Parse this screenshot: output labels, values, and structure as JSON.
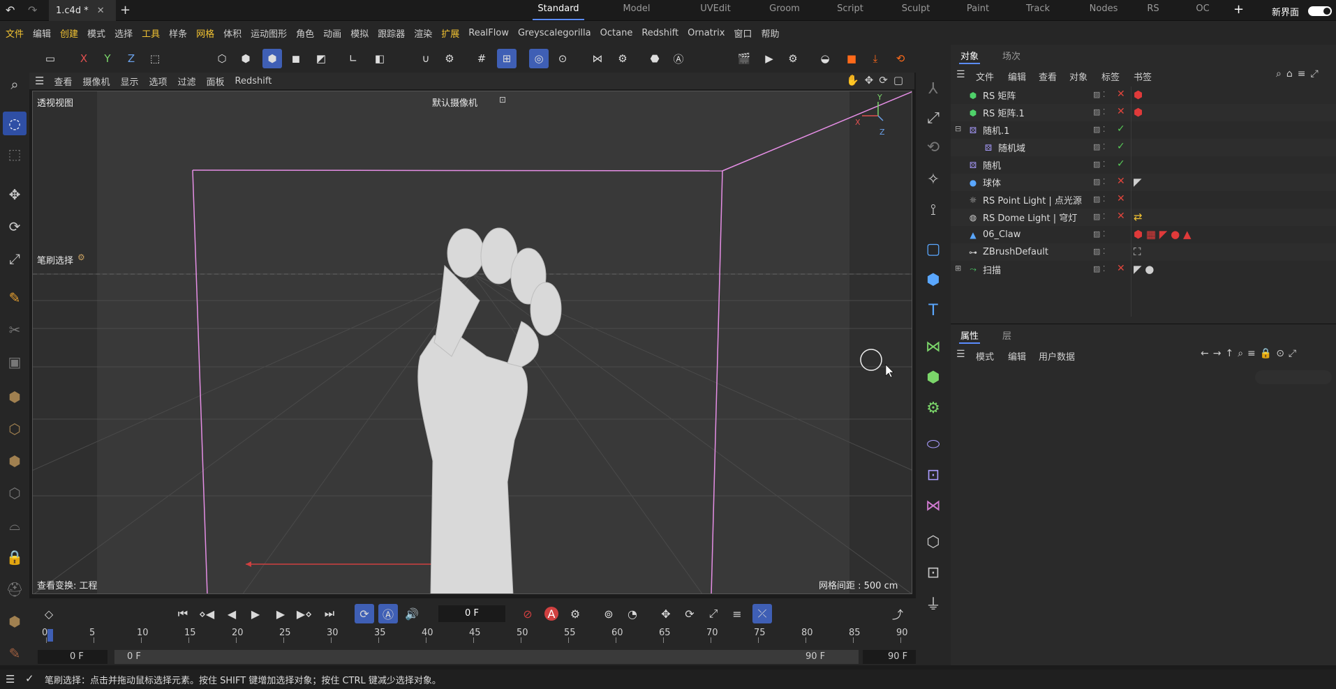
{
  "document_tab": "1.c4d *",
  "layouts": [
    "Standard",
    "Model",
    "UVEdit",
    "Groom",
    "Script",
    "Sculpt",
    "Paint",
    "Track",
    "Nodes",
    "RS",
    "OC"
  ],
  "active_layout": "Standard",
  "new_interface_label": "新界面",
  "menu": [
    "文件",
    "编辑",
    "创建",
    "模式",
    "选择",
    "工具",
    "样条",
    "网格",
    "体积",
    "运动图形",
    "角色",
    "动画",
    "模拟",
    "跟踪器",
    "渲染",
    "扩展",
    "RealFlow",
    "Greyscalegorilla",
    "Octane",
    "Redshift",
    "Ornatrix",
    "窗口",
    "帮助"
  ],
  "highlighted_menu": [
    "文件",
    "创建",
    "工具",
    "网格",
    "扩展"
  ],
  "axes": [
    "X",
    "Y",
    "Z"
  ],
  "viewport_menu": [
    "查看",
    "摄像机",
    "显示",
    "选项",
    "过滤",
    "面板",
    "Redshift"
  ],
  "viewport": {
    "view_name": "透视视图",
    "camera": "默认摄像机",
    "tool_label": "笔刷选择",
    "transform_label": "查看变换: 工程",
    "grid_spacing": "网格间距 : 500 cm",
    "axis_x": "X",
    "axis_y": "Y",
    "axis_z": "Z"
  },
  "object_panel": {
    "tabs": [
      "对象",
      "场次"
    ],
    "menu": [
      "文件",
      "编辑",
      "查看",
      "对象",
      "标签",
      "书签"
    ],
    "rows": [
      {
        "name": "RS 矩阵",
        "icon": "cube-green-icon",
        "status": "x",
        "tag": "red-cube"
      },
      {
        "name": "RS 矩阵.1",
        "icon": "cube-green-icon",
        "status": "x",
        "tag": "red-cube"
      },
      {
        "name": "随机.1",
        "icon": "random-icon",
        "status": "check",
        "tag": "",
        "expand": "⊟"
      },
      {
        "name": "随机域",
        "icon": "random-icon",
        "status": "check",
        "tag": "",
        "indent": true
      },
      {
        "name": "随机",
        "icon": "random-icon",
        "status": "check",
        "tag": ""
      },
      {
        "name": "球体",
        "icon": "sphere-icon",
        "status": "x",
        "tag": "phong"
      },
      {
        "name": "RS Point Light | 点光源",
        "icon": "light-icon",
        "status": "x",
        "tag": ""
      },
      {
        "name": "RS Dome Light | 穹灯",
        "icon": "globe-icon",
        "status": "x",
        "tag": "yellow"
      },
      {
        "name": "06_Claw",
        "icon": "poly-icon",
        "status": "",
        "tag": "multi"
      },
      {
        "name": "ZBrushDefault",
        "icon": "null-icon",
        "status": "",
        "tag": "box"
      },
      {
        "name": "扫描",
        "icon": "sweep-icon",
        "status": "x",
        "tag": "phong-black",
        "expand": "⊞"
      }
    ]
  },
  "attr_panel": {
    "tabs": [
      "属性",
      "层"
    ],
    "menu": [
      "模式",
      "编辑",
      "用户数据"
    ]
  },
  "timeline": {
    "current_frame": "0 F",
    "ruler": [
      "0",
      "5",
      "10",
      "15",
      "20",
      "25",
      "30",
      "35",
      "40",
      "45",
      "50",
      "55",
      "60",
      "65",
      "70",
      "75",
      "80",
      "85",
      "90"
    ],
    "start": "0 F",
    "range_start": "0 F",
    "range_end": "90 F",
    "end": "90 F"
  },
  "status_text": "笔刷选择：点击并拖动鼠标选择元素。按住 SHIFT 键增加选择对象；按住 CTRL 键减少选择对象。",
  "colors": {
    "accent": "#3f5fb5",
    "cage": "#e58ee5",
    "highlight_menu": "#f1c232"
  }
}
